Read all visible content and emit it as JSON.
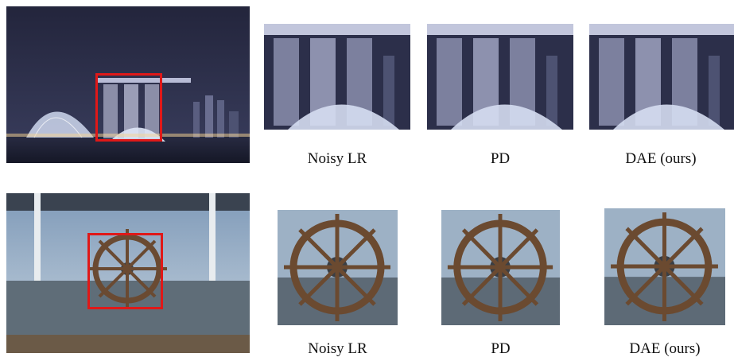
{
  "rows": [
    {
      "scene": "city-night-skyline",
      "captions": [
        "Noisy LR",
        "PD",
        "DAE (ours)"
      ]
    },
    {
      "scene": "ship-steering-wheel",
      "captions": [
        "Noisy LR",
        "PD",
        "DAE (ours)"
      ]
    }
  ],
  "colors": {
    "roi_box": "#e01818",
    "night_sky": "#2a2c44",
    "day_sky": "#8ea8c4"
  }
}
